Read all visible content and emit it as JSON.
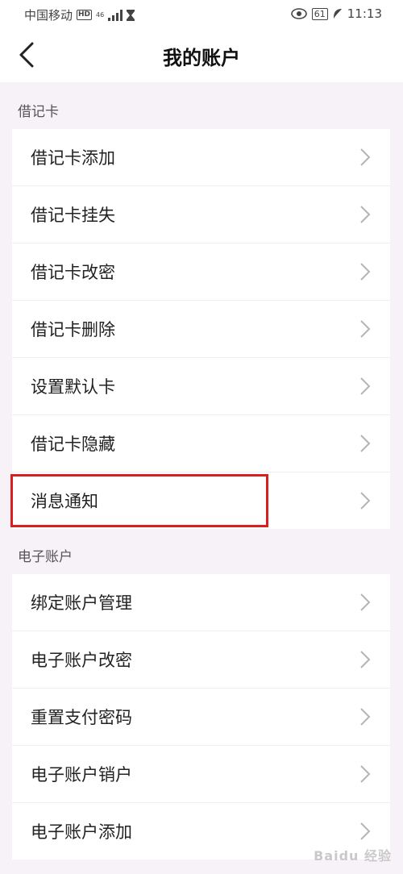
{
  "status_bar": {
    "carrier": "中国移动",
    "hd": "HD",
    "net_top": "46",
    "net_bottom": "⁴⁶",
    "battery": "61",
    "time": "11:13"
  },
  "header": {
    "title": "我的账户"
  },
  "sections": [
    {
      "label": "借记卡",
      "items": [
        "借记卡添加",
        "借记卡挂失",
        "借记卡改密",
        "借记卡删除",
        "设置默认卡",
        "借记卡隐藏",
        "消息通知"
      ]
    },
    {
      "label": "电子账户",
      "items": [
        "绑定账户管理",
        "电子账户改密",
        "重置支付密码",
        "电子账户销户",
        "电子账户添加"
      ]
    }
  ],
  "watermark": "Baidu 经验",
  "colors": {
    "highlight": "#d9201f",
    "background": "#f7f1f8"
  }
}
